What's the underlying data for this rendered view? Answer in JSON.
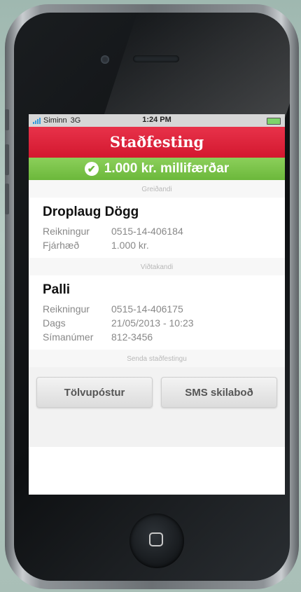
{
  "status": {
    "carrier": "Siminn",
    "network": "3G",
    "time": "1:24 PM"
  },
  "header": {
    "title": "Staðfesting"
  },
  "banner": {
    "message": "1.000 kr. millifærðar",
    "icon": "check-circle-icon",
    "color": "#6cb83b"
  },
  "sender": {
    "section_label": "Greiðandi",
    "name": "Droplaug Dögg",
    "rows": [
      {
        "label": "Reikningur",
        "value": "0515-14-406184"
      },
      {
        "label": "Fjárhæð",
        "value": "1.000 kr."
      }
    ]
  },
  "recipient": {
    "section_label": "Viðtakandi",
    "name": "Palli",
    "rows": [
      {
        "label": "Reikningur",
        "value": "0515-14-406175"
      },
      {
        "label": "Dags",
        "value": "21/05/2013 - 10:23"
      },
      {
        "label": "Símanúmer",
        "value": "812-3456"
      }
    ]
  },
  "send": {
    "section_label": "Senda staðfestingu",
    "email_button": "Tölvupóstur",
    "sms_button": "SMS skilaboð"
  },
  "colors": {
    "header": "#d3182f",
    "success": "#6cb83b"
  }
}
